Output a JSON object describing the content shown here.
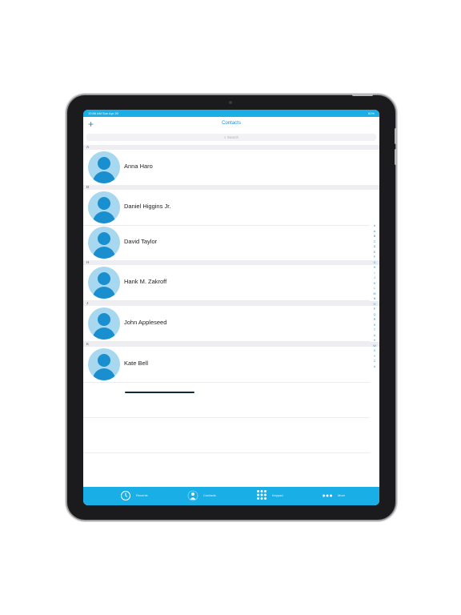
{
  "status": {
    "left": "10:56 AM  Sun Apr 20",
    "right": "81%"
  },
  "nav": {
    "add_icon": "+",
    "title": "Contacts"
  },
  "search": {
    "placeholder": "Search",
    "icon": "magnifier-icon"
  },
  "sections": [
    {
      "letter": "A",
      "contacts": [
        "Anna Haro"
      ]
    },
    {
      "letter": "D",
      "contacts": [
        "Daniel Higgins Jr.",
        "David Taylor"
      ]
    },
    {
      "letter": "H",
      "contacts": [
        "Hank M. Zakroff"
      ]
    },
    {
      "letter": "J",
      "contacts": [
        "John Appleseed"
      ]
    },
    {
      "letter": "K",
      "contacts": [
        "Kate Bell"
      ]
    }
  ],
  "index": [
    "#",
    "A",
    "B",
    "C",
    "D",
    "E",
    "F",
    "G",
    "H",
    "I",
    "J",
    "K",
    "L",
    "M",
    "N",
    "O",
    "P",
    "Q",
    "R",
    "S",
    "T",
    "U",
    "V",
    "W",
    "X",
    "Y",
    "Z",
    "#"
  ],
  "tabs": [
    {
      "label": "Recents",
      "icon": "clock-icon"
    },
    {
      "label": "Contacts",
      "icon": "person-icon"
    },
    {
      "label": "Keypad",
      "icon": "keypad-icon"
    },
    {
      "label": "More",
      "icon": "more-icon"
    }
  ],
  "colors": {
    "accent": "#19aee6",
    "tint": "#1a8fd0",
    "avatar_bg": "#a7d8ef"
  }
}
